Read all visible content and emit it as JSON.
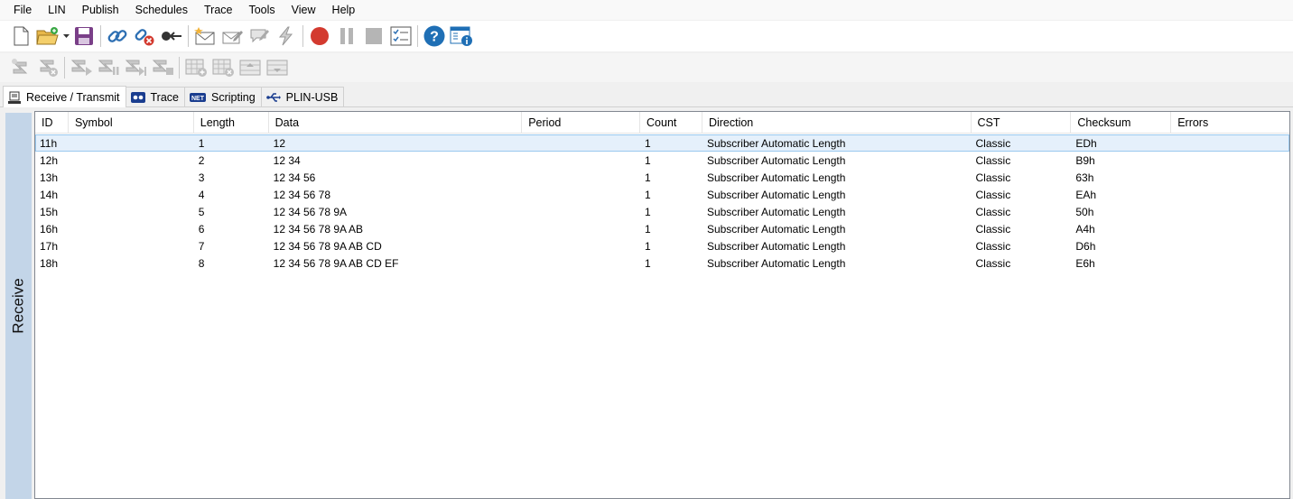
{
  "menu": [
    "File",
    "LIN",
    "Publish",
    "Schedules",
    "Trace",
    "Tools",
    "View",
    "Help"
  ],
  "toolbar1_icons": [
    "new-document-icon",
    "open-folder-icon",
    "save-icon",
    "connect-icon",
    "disconnect-icon",
    "plug-icon",
    "new-message-icon",
    "edit-message-icon",
    "message-props-icon",
    "lightning-icon",
    "record-icon",
    "pause-icon",
    "stop-icon",
    "checklist-icon",
    "help-icon",
    "about-icon"
  ],
  "toolbar2_icons": [
    "transmit-new-icon",
    "transmit-delete-icon",
    "play-icon",
    "pause-transmit-icon",
    "step-icon",
    "stop-transmit-icon",
    "grid-add-icon",
    "grid-remove-icon",
    "grid-up-icon",
    "grid-down-icon"
  ],
  "tabs": [
    {
      "label": "Receive / Transmit",
      "icon": "receive-transmit-icon",
      "active": true
    },
    {
      "label": "Trace",
      "icon": "tape-icon",
      "active": false
    },
    {
      "label": "Scripting",
      "icon": "net-icon",
      "active": false
    },
    {
      "label": "PLIN-USB",
      "icon": "usb-icon",
      "active": false
    }
  ],
  "sidebar": {
    "label": "Receive"
  },
  "table": {
    "columns": [
      "ID",
      "Symbol",
      "Length",
      "Data",
      "Period",
      "Count",
      "Direction",
      "CST",
      "Checksum",
      "Errors"
    ],
    "rows": [
      {
        "id": "11h",
        "symbol": "",
        "length": "1",
        "data": "12",
        "period": "",
        "count": "1",
        "direction": "Subscriber Automatic Length",
        "cst": "Classic",
        "checksum": "EDh",
        "errors": ""
      },
      {
        "id": "12h",
        "symbol": "",
        "length": "2",
        "data": "12 34",
        "period": "",
        "count": "1",
        "direction": "Subscriber Automatic Length",
        "cst": "Classic",
        "checksum": "B9h",
        "errors": ""
      },
      {
        "id": "13h",
        "symbol": "",
        "length": "3",
        "data": "12 34 56",
        "period": "",
        "count": "1",
        "direction": "Subscriber Automatic Length",
        "cst": "Classic",
        "checksum": "63h",
        "errors": ""
      },
      {
        "id": "14h",
        "symbol": "",
        "length": "4",
        "data": "12 34 56 78",
        "period": "",
        "count": "1",
        "direction": "Subscriber Automatic Length",
        "cst": "Classic",
        "checksum": "EAh",
        "errors": ""
      },
      {
        "id": "15h",
        "symbol": "",
        "length": "5",
        "data": "12 34 56 78 9A",
        "period": "",
        "count": "1",
        "direction": "Subscriber Automatic Length",
        "cst": "Classic",
        "checksum": "50h",
        "errors": ""
      },
      {
        "id": "16h",
        "symbol": "",
        "length": "6",
        "data": "12 34 56 78 9A AB",
        "period": "",
        "count": "1",
        "direction": "Subscriber Automatic Length",
        "cst": "Classic",
        "checksum": "A4h",
        "errors": ""
      },
      {
        "id": "17h",
        "symbol": "",
        "length": "7",
        "data": "12 34 56 78 9A AB CD",
        "period": "",
        "count": "1",
        "direction": "Subscriber Automatic Length",
        "cst": "Classic",
        "checksum": "D6h",
        "errors": ""
      },
      {
        "id": "18h",
        "symbol": "",
        "length": "8",
        "data": "12 34 56 78 9A AB CD EF",
        "period": "",
        "count": "1",
        "direction": "Subscriber Automatic Length",
        "cst": "Classic",
        "checksum": "E6h",
        "errors": ""
      }
    ]
  },
  "colors": {
    "record": "#d33a2f",
    "help": "#1f6fb5",
    "link": "#2d6fb3",
    "selection": "#e5f0fb",
    "sidebar": "#c3d5e8"
  }
}
